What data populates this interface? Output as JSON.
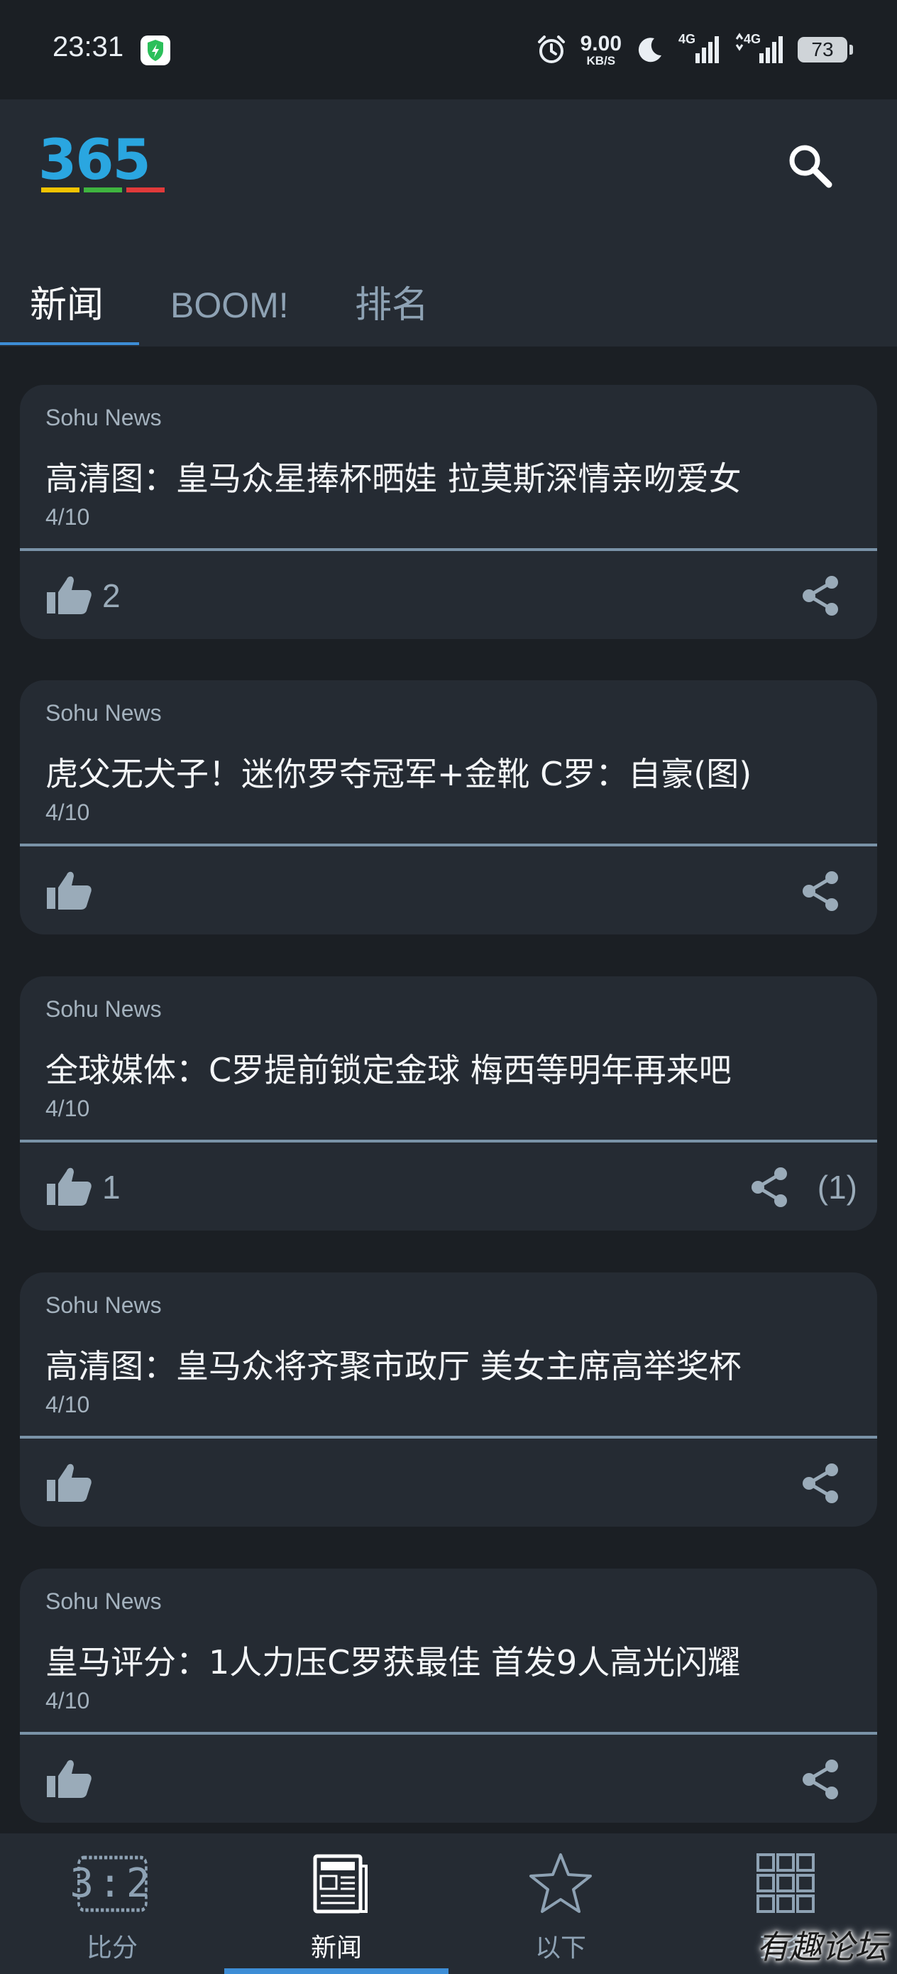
{
  "status_bar": {
    "time": "23:31",
    "net_speed": "9.00",
    "net_speed_unit": "KB/S",
    "signal1": "4G",
    "signal2": "4G",
    "battery": "73",
    "icons": [
      "shield-icon",
      "alarm-icon",
      "moon-icon",
      "signal-icon",
      "battery-icon"
    ]
  },
  "header": {
    "logo_text": "365",
    "search_icon": "search-icon"
  },
  "tabs": [
    {
      "label": "新闻",
      "active": true
    },
    {
      "label": "BOOM!",
      "active": false
    },
    {
      "label": "排名",
      "active": false
    }
  ],
  "news": [
    {
      "source": "Sohu News",
      "title": "高清图：皇马众星捧杯晒娃 拉莫斯深情亲吻爱女",
      "date": "4/10",
      "likes": "2",
      "shares": ""
    },
    {
      "source": "Sohu News",
      "title": "虎父无犬子！迷你罗夺冠军+金靴 C罗：自豪(图)",
      "date": "4/10",
      "likes": "",
      "shares": ""
    },
    {
      "source": "Sohu News",
      "title": "全球媒体：C罗提前锁定金球 梅西等明年再来吧",
      "date": "4/10",
      "likes": "1",
      "shares": "(1)"
    },
    {
      "source": "Sohu News",
      "title": "高清图：皇马众将齐聚市政厅 美女主席高举奖杯",
      "date": "4/10",
      "likes": "",
      "shares": ""
    },
    {
      "source": "Sohu News",
      "title": "皇马评分：1人力压C罗获最佳 首发9人高光闪耀",
      "date": "4/10",
      "likes": "",
      "shares": ""
    }
  ],
  "bottom_nav": [
    {
      "label": "比分",
      "icon": "scoreboard-icon",
      "score_text": "3:2",
      "active": false
    },
    {
      "label": "新闻",
      "icon": "newspaper-icon",
      "active": true
    },
    {
      "label": "以下",
      "icon": "star-icon",
      "active": false
    },
    {
      "label": "更多",
      "icon": "grid-icon",
      "active": false
    }
  ],
  "watermark": "有趣论坛",
  "colors": {
    "background": "#1b1f24",
    "surface": "#252b33",
    "accent": "#3d8dd6",
    "muted_text": "#8ea2b4"
  }
}
